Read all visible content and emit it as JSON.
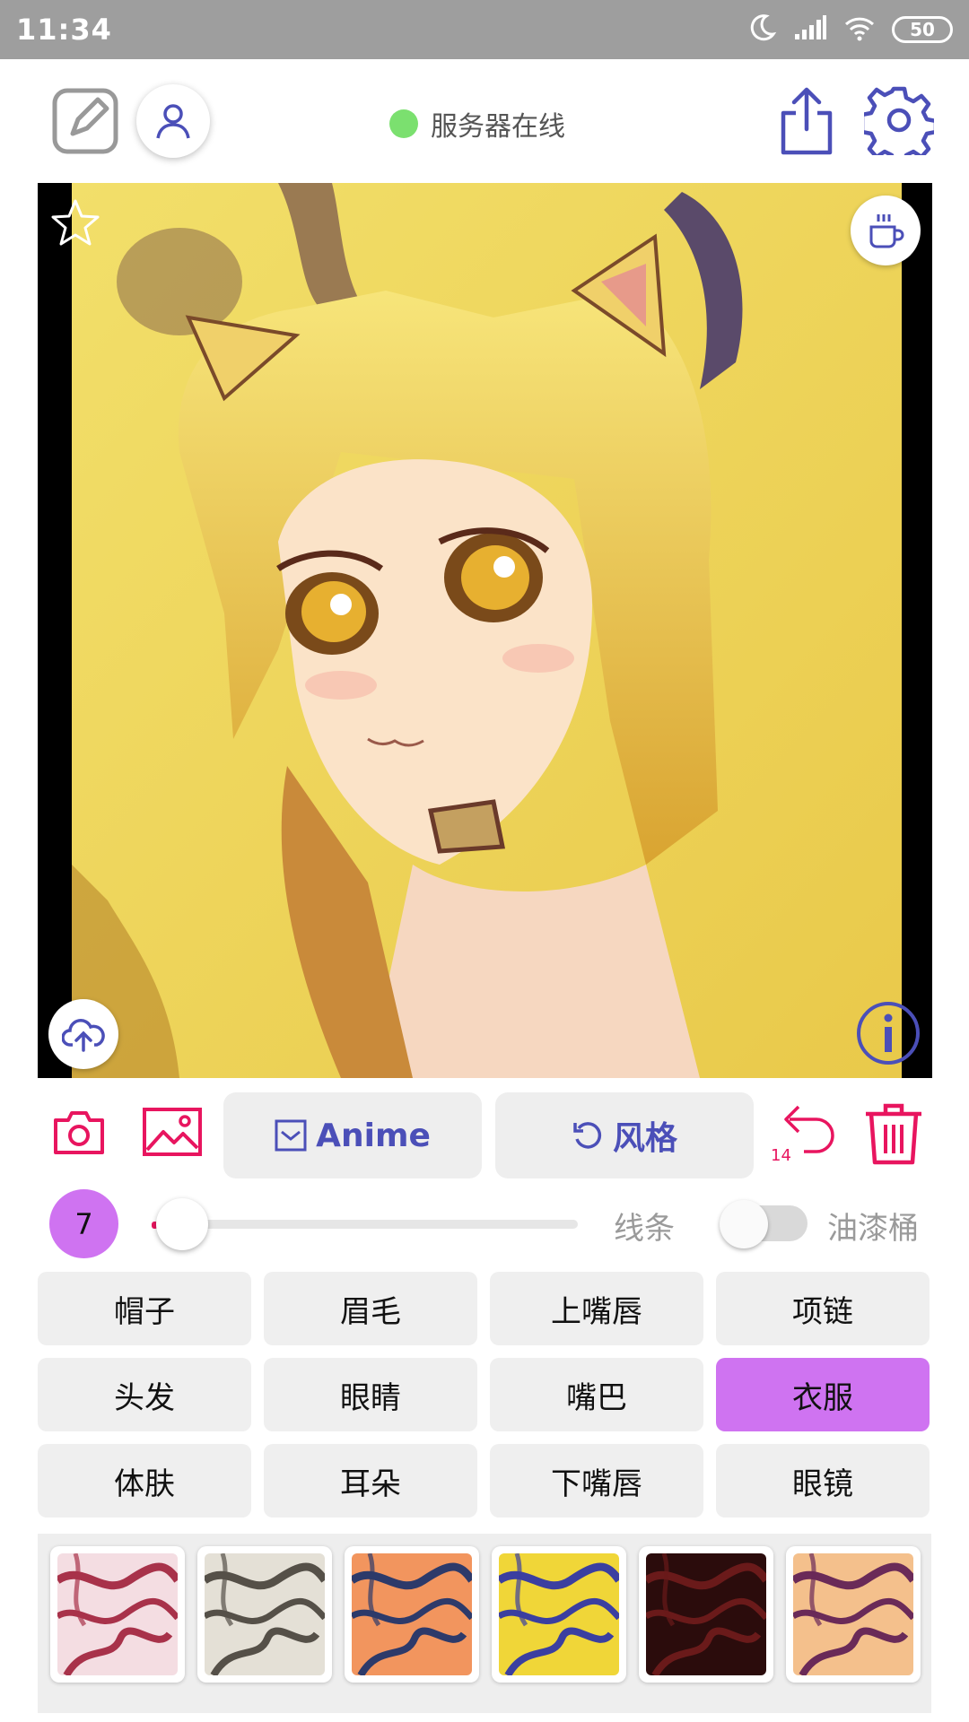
{
  "status_bar": {
    "time": "11:34",
    "battery": "50"
  },
  "header": {
    "server_status": "服务器在线",
    "server_status_color": "#7be06f"
  },
  "actions": {
    "style_label": "Anime",
    "style2_label": "风格",
    "undo_count": "14"
  },
  "slider": {
    "brush_size": "7",
    "value_fraction": 0.02,
    "line_label": "线条",
    "bucket_label": "油漆桶",
    "bucket_on": false
  },
  "parts": [
    {
      "label": "帽子",
      "selected": false
    },
    {
      "label": "眉毛",
      "selected": false
    },
    {
      "label": "上嘴唇",
      "selected": false
    },
    {
      "label": "项链",
      "selected": false
    },
    {
      "label": "头发",
      "selected": false
    },
    {
      "label": "眼睛",
      "selected": false
    },
    {
      "label": "嘴巴",
      "selected": false
    },
    {
      "label": "衣服",
      "selected": true
    },
    {
      "label": "体肤",
      "selected": false
    },
    {
      "label": "耳朵",
      "selected": false
    },
    {
      "label": "下嘴唇",
      "selected": false
    },
    {
      "label": "眼镜",
      "selected": false
    }
  ],
  "swatches": [
    {
      "name": "pink-white-texture",
      "base": "#f4dde2",
      "stroke": "#a8324a"
    },
    {
      "name": "gray-white-texture",
      "base": "#e4e0d6",
      "stroke": "#555048"
    },
    {
      "name": "orange-navy-texture",
      "base": "#f2955e",
      "stroke": "#2d3a6a"
    },
    {
      "name": "yellow-blue-texture",
      "base": "#f0d638",
      "stroke": "#3b3fa0"
    },
    {
      "name": "dark-red-texture",
      "base": "#2b0c0c",
      "stroke": "#6a1a1a"
    },
    {
      "name": "peach-purple-texture",
      "base": "#f4c08c",
      "stroke": "#6a2a58"
    }
  ],
  "colors": {
    "accent": "#cf73f1",
    "primary": "#4b4fb8",
    "danger": "#e8155f"
  }
}
